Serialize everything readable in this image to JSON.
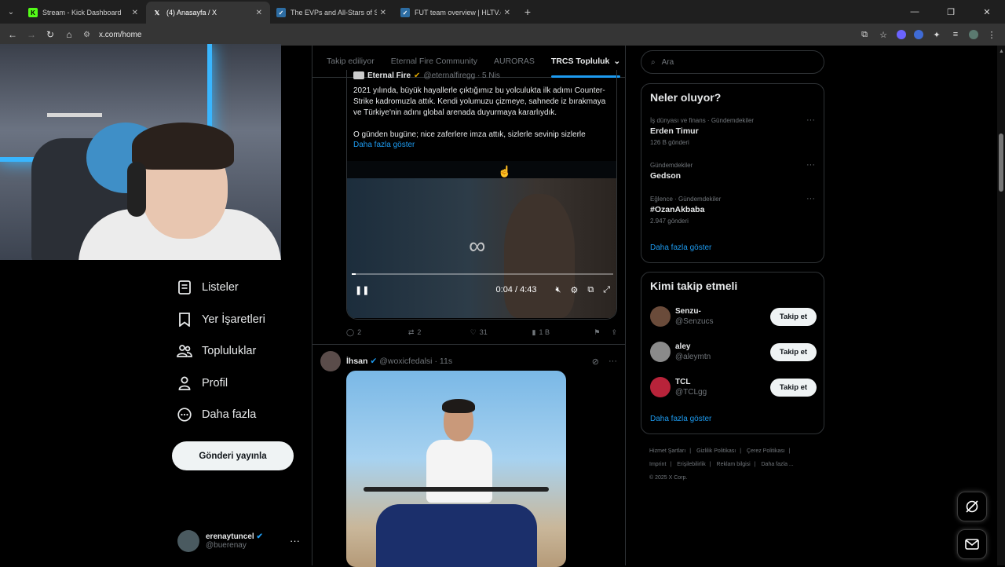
{
  "browser": {
    "tabs": [
      {
        "title": "Stream - Kick Dashboard",
        "favicon": "kick-icon",
        "color": "#53fc18",
        "active": false
      },
      {
        "title": "(4) Anasayfa / X",
        "favicon": "x-icon",
        "color": "#ffffff",
        "active": true
      },
      {
        "title": "The EVPs and All-Stars of Starl...",
        "favicon": "hltv-icon",
        "color": "#2d6da3",
        "active": false
      },
      {
        "title": "FUT team overview | HLTV.org",
        "favicon": "hltv-icon",
        "color": "#2d6da3",
        "active": false
      }
    ],
    "url": "x.com/home"
  },
  "sidebar": {
    "items": [
      {
        "label": "Listeler",
        "icon": "list-icon"
      },
      {
        "label": "Yer İşaretleri",
        "icon": "bookmark-icon"
      },
      {
        "label": "Topluluklar",
        "icon": "communities-icon"
      },
      {
        "label": "Profil",
        "icon": "profile-icon"
      },
      {
        "label": "Daha fazla",
        "icon": "more-circle-icon"
      }
    ],
    "post_button": "Gönderi yayınla",
    "account": {
      "name": "erenaytuncel",
      "handle": "@buerenay"
    }
  },
  "timeline": {
    "tabs": [
      "Takip ediliyor",
      "Eternal Fire Community",
      "AURORAS",
      "TRCS Topluluk"
    ],
    "active_tab": "TRCS Topluluk",
    "quoted": {
      "name": "Eternal Fire",
      "handle": "@eternalfiregg · 5 Nis",
      "p1": "2021 yılında, büyük hayallerle çıktığımız bu yolculukta ilk adımı Counter-Strike kadromuzla attık. Kendi yolumuzu çizmeye, sahnede iz bırakmaya ve Türkiye'nin adını global arenada duyurmaya kararlıydık.",
      "p2": "O günden bugüne; nice zaferlere imza attık, sizlerle sevinip sizlerle",
      "show_more": "Daha fazla göster",
      "video_time": "0:04 / 4:43",
      "progress": 0.015
    },
    "actions": {
      "replies": "2",
      "reposts": "2",
      "likes": "31",
      "views": "1 B"
    },
    "post2": {
      "name": "İhsan",
      "handle": "@woxicfedalsi",
      "time": "· 11s"
    }
  },
  "right": {
    "search_placeholder": "Ara",
    "trends_title": "Neler oluyor?",
    "trends": [
      {
        "category": "İş dünyası ve finans · Gündemdekiler",
        "title": "Erden Timur",
        "count": "126 B gönderi"
      },
      {
        "category": "Gündemdekiler",
        "title": "Gedson",
        "count": ""
      },
      {
        "category": "Eğlence · Gündemdekiler",
        "title": "#OzanAkbaba",
        "count": "2.947 gönderi"
      }
    ],
    "trends_more": "Daha fazla göster",
    "follow_title": "Kimi takip etmeli",
    "follow": [
      {
        "name": "Senzu-",
        "handle": "@Senzucs",
        "button": "Takip et",
        "color": "#6a4b3a"
      },
      {
        "name": "aley",
        "handle": "@aleymtn",
        "button": "Takip et",
        "color": "#8a8a8a"
      },
      {
        "name": "TCL",
        "handle": "@TCLgg",
        "button": "Takip et",
        "color": "#b8233a"
      }
    ],
    "follow_more": "Daha fazla göster",
    "footer": [
      "Hizmet Şartları",
      "|",
      "Gizlilik Politikası",
      "|",
      "Çerez Politikası",
      "|",
      "Imprint",
      "|",
      "Erişilebilirlik",
      "|",
      "Reklam bilgisi",
      "|",
      "Daha fazla ...",
      "© 2025 X Corp."
    ]
  }
}
